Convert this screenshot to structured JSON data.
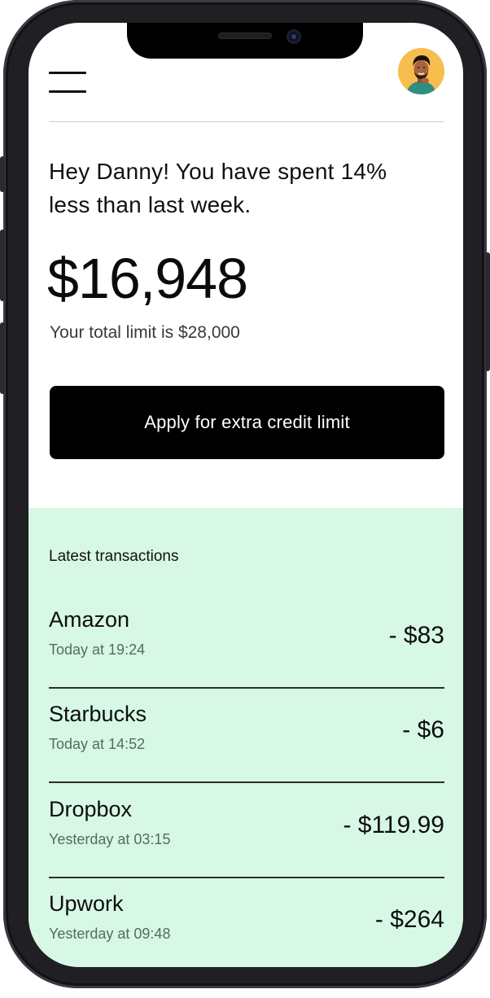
{
  "greeting": "Hey Danny! You have spent 14% less than last week.",
  "balance": "$16,948",
  "limit_text": "Your total limit is $28,000",
  "cta_label": "Apply for extra credit limit",
  "transactions": {
    "heading": "Latest transactions",
    "items": [
      {
        "name": "Amazon",
        "time": "Today at 19:24",
        "amount": "- $83"
      },
      {
        "name": "Starbucks",
        "time": "Today at 14:52",
        "amount": "- $6"
      },
      {
        "name": "Dropbox",
        "time": "Yesterday at 03:15",
        "amount": "- $119.99"
      },
      {
        "name": "Upwork",
        "time": "Yesterday at 09:48",
        "amount": "- $264"
      }
    ]
  },
  "colors": {
    "accent_panel": "#d7f8e5",
    "cta_bg": "#000000",
    "avatar_bg": "#f7be4e"
  },
  "icons": {
    "menu": "hamburger-menu-icon",
    "avatar": "user-avatar"
  }
}
